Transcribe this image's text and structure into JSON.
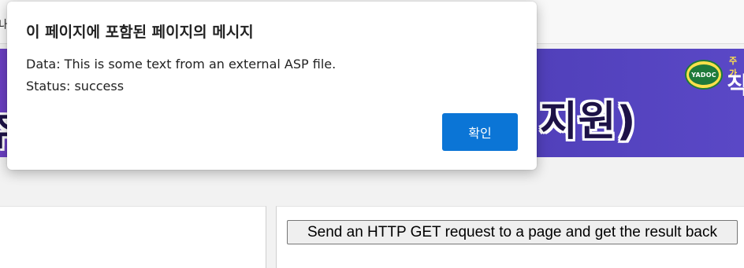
{
  "background_page": {
    "top_partial_text": "내",
    "banner": {
      "hero_text": "비지원)",
      "left_fragment": "주",
      "logo_badge_text": "YADOC",
      "logo_small_text": "주가",
      "logo_big_text": "직"
    },
    "get_button_label": "Send an HTTP GET request to a page and get the result back"
  },
  "dialog": {
    "title": "이 페이지에 포함된 페이지의 메시지",
    "line1": "Data: This is some text from an external ASP file.",
    "line2": "Status: success",
    "ok_label": "확인"
  },
  "colors": {
    "ok_button": "#0b75d6",
    "banner_purple": "#5a48c6"
  }
}
